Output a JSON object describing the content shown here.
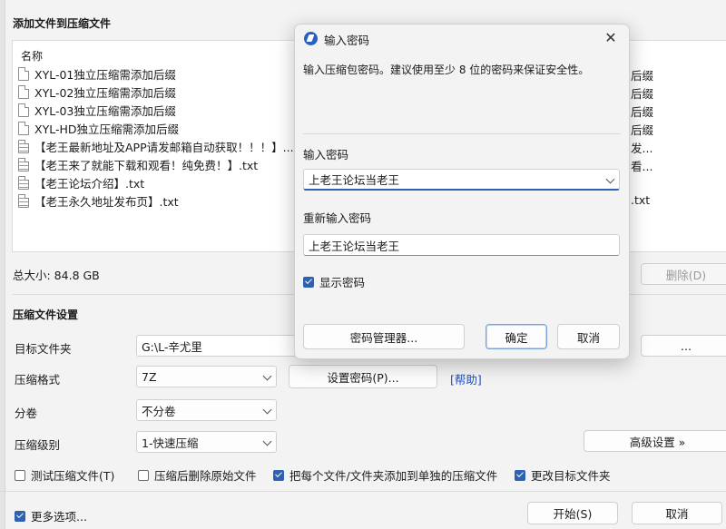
{
  "main": {
    "title": "添加文件到压缩文件",
    "list_header": "名称",
    "files": [
      {
        "name": "XYL-01独立压缩需添加后缀",
        "type": "file",
        "side": "后缀"
      },
      {
        "name": "XYL-02独立压缩需添加后缀",
        "type": "file",
        "side": "后缀"
      },
      {
        "name": "XYL-03独立压缩需添加后缀",
        "type": "file",
        "side": "后缀"
      },
      {
        "name": "XYL-HD独立压缩需添加后缀",
        "type": "file",
        "side": "后缀"
      },
      {
        "name": "【老王最新地址及APP请发邮箱自动获取！！！】....",
        "type": "txt",
        "side": "发..."
      },
      {
        "name": "【老王来了就能下载和观看！纯免费！】.txt",
        "type": "txt",
        "side": "看..."
      },
      {
        "name": "【老王论坛介绍】.txt",
        "type": "txt",
        "side": ""
      },
      {
        "name": "【老王永久地址发布页】.txt",
        "type": "txt",
        "side": ".txt"
      }
    ],
    "total_size": "总大小: 84.8 GB",
    "delete_button": "删除(D)",
    "settings_title": "压缩文件设置",
    "target_label": "目标文件夹",
    "target_value": "G:\\L-辛尤里",
    "browse_button": "...",
    "format_label": "压缩格式",
    "format_value": "7Z",
    "set_password_button": "设置密码(P)...",
    "help_link": "[帮助]",
    "split_label": "分卷",
    "split_value": "不分卷",
    "level_label": "压缩级别",
    "level_value": "1-快速压缩",
    "advanced_button": "高级设置 »",
    "options": {
      "test": "测试压缩文件(T)",
      "delete_source": "压缩后删除原始文件",
      "separate": "把每个文件/文件夹添加到单独的压缩文件",
      "change_target": "更改目标文件夹"
    },
    "more_options": "更多选项...",
    "start_button": "开始(S)",
    "cancel_button": "取消"
  },
  "dialog": {
    "title": "输入密码",
    "description": "输入压缩包密码。建议使用至少 8 位的密码来保证安全性。",
    "password_label": "输入密码",
    "password_value": "上老王论坛当老王",
    "reenter_label": "重新输入密码",
    "reenter_value": "上老王论坛当老王",
    "show_password": "显示密码",
    "manager_button": "密码管理器...",
    "ok_button": "确定",
    "cancel_button": "取消"
  }
}
